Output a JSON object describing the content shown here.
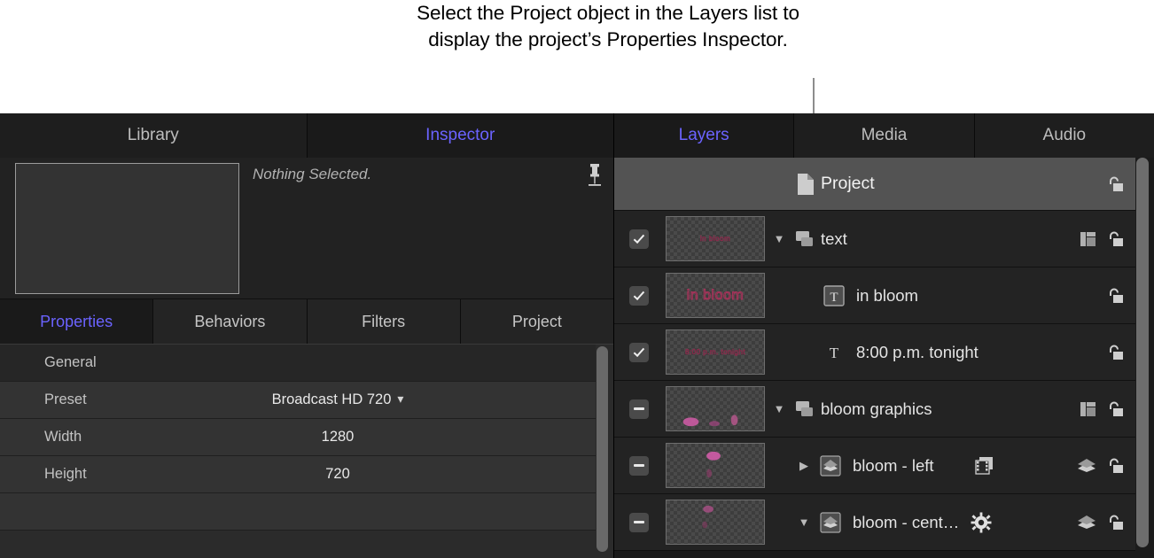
{
  "caption": {
    "text": "Select the Project object in the Layers list to display the project’s Properties Inspector."
  },
  "left_pane": {
    "tabs": [
      {
        "label": "Library",
        "active": false
      },
      {
        "label": "Inspector",
        "active": true
      }
    ],
    "preview": {
      "status_text": "Nothing Selected.",
      "pin_icon": "pin-icon"
    },
    "subtabs": [
      {
        "label": "Properties",
        "active": true
      },
      {
        "label": "Behaviors",
        "active": false
      },
      {
        "label": "Filters",
        "active": false
      },
      {
        "label": "Project",
        "active": false
      }
    ],
    "parameters": {
      "group_header": "General",
      "rows": [
        {
          "label": "Preset",
          "value": "Broadcast HD 720",
          "has_stepper": true
        },
        {
          "label": "Width",
          "value": "1280",
          "has_stepper": false
        },
        {
          "label": "Height",
          "value": "720",
          "has_stepper": false
        }
      ]
    }
  },
  "right_pane": {
    "tabs": [
      {
        "label": "Layers",
        "active": true
      },
      {
        "label": "Media",
        "active": false
      },
      {
        "label": "Audio",
        "active": false
      }
    ],
    "rows": [
      {
        "name": "Project",
        "selected": true,
        "checkbox": "none",
        "thumbnail": "none",
        "thumb_text": "",
        "disclosure": "none",
        "type_icon": "document-icon",
        "indent": 0,
        "extra_icon": "none",
        "right_icons": [
          "unlock-icon"
        ]
      },
      {
        "name": "text",
        "selected": false,
        "checkbox": "checked",
        "thumbnail": "checker",
        "thumb_text": "in bloom",
        "disclosure": "expanded",
        "type_icon": "group-icon",
        "indent": 0,
        "extra_icon": "none",
        "right_icons": [
          "mask-icon",
          "unlock-icon"
        ]
      },
      {
        "name": "in bloom",
        "selected": false,
        "checkbox": "checked",
        "thumbnail": "checker",
        "thumb_text": "in bloom",
        "disclosure": "none",
        "type_icon": "text-boxed-icon",
        "indent": 1,
        "extra_icon": "none",
        "right_icons": [
          "unlock-icon"
        ]
      },
      {
        "name": "8:00 p.m. tonight",
        "selected": false,
        "checkbox": "checked",
        "thumbnail": "checker",
        "thumb_text": "8:00 p.m. tonight",
        "disclosure": "none",
        "type_icon": "text-icon",
        "indent": 1,
        "extra_icon": "none",
        "right_icons": [
          "unlock-icon"
        ]
      },
      {
        "name": "bloom graphics",
        "selected": false,
        "checkbox": "mixed",
        "thumbnail": "petals",
        "thumb_text": "",
        "disclosure": "expanded",
        "type_icon": "group-icon",
        "indent": 0,
        "extra_icon": "none",
        "right_icons": [
          "mask-icon",
          "unlock-icon"
        ]
      },
      {
        "name": "bloom - left",
        "selected": false,
        "checkbox": "mixed",
        "thumbnail": "petal-single",
        "thumb_text": "",
        "disclosure": "collapsed",
        "type_icon": "particle-icon",
        "indent": 1,
        "extra_icon": "media-icon",
        "right_icons": [
          "layers-icon",
          "unlock-icon"
        ]
      },
      {
        "name": "bloom - cent…",
        "selected": false,
        "checkbox": "mixed",
        "thumbnail": "petal-single",
        "thumb_text": "",
        "disclosure": "expanded",
        "type_icon": "particle-icon",
        "indent": 1,
        "extra_icon": "gear-icon",
        "right_icons": [
          "layers-icon",
          "unlock-icon"
        ]
      }
    ]
  },
  "colors": {
    "accent": "#6b63ff",
    "window_bg": "#1c1c1c",
    "row_bg": "#232323",
    "row_selected_bg": "#535353",
    "thumb_pink": "#a8325a",
    "text_primary": "#e4e4e4",
    "text_secondary": "#c3c3c3"
  }
}
